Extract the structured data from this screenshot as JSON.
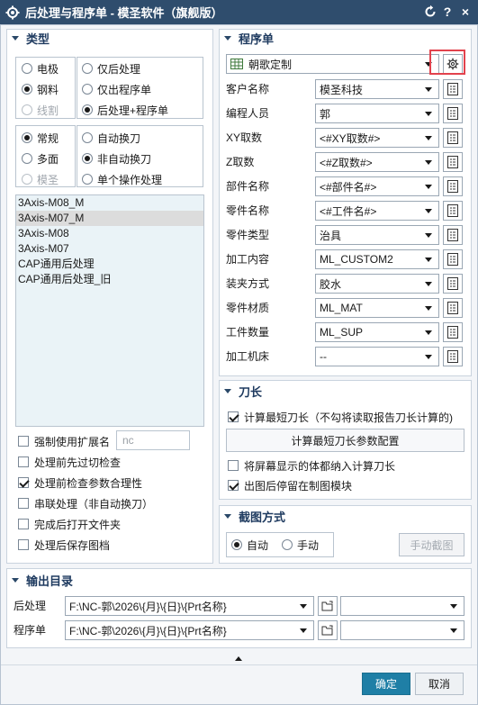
{
  "window": {
    "title": "后处理与程序单 - 模圣软件（旗舰版）",
    "refresh_icon": "refresh-icon",
    "help_label": "?",
    "close_label": "×"
  },
  "type_section": {
    "title": "类型",
    "group1": [
      {
        "label": "电极",
        "checked": false,
        "disabled": false
      },
      {
        "label": "钢料",
        "checked": true,
        "disabled": false
      },
      {
        "label": "线割",
        "checked": false,
        "disabled": true
      }
    ],
    "group2": [
      {
        "label": "仅后处理",
        "checked": false
      },
      {
        "label": "仅出程序单",
        "checked": false
      },
      {
        "label": "后处理+程序单",
        "checked": true
      }
    ],
    "group3": [
      {
        "label": "常规",
        "checked": true,
        "disabled": false
      },
      {
        "label": "多面",
        "checked": false,
        "disabled": false
      },
      {
        "label": "模圣",
        "checked": false,
        "disabled": true
      }
    ],
    "group4": [
      {
        "label": "自动换刀",
        "checked": false
      },
      {
        "label": "非自动换刀",
        "checked": true
      },
      {
        "label": "单个操作处理",
        "checked": false
      }
    ],
    "posts": [
      "3Axis-M08_M",
      "3Axis-M07_M",
      "3Axis-M08",
      "3Axis-M07",
      "CAP通用后处理",
      "CAP通用后处理_旧"
    ],
    "selected_post": "3Axis-M07_M",
    "options": {
      "force_ext": {
        "label": "强制使用扩展名",
        "checked": false,
        "value": "nc"
      },
      "precut": {
        "label": "处理前先过切检查",
        "checked": false
      },
      "check_params": {
        "label": "处理前检查参数合理性",
        "checked": true
      },
      "serial": {
        "label": "串联处理（非自动换刀）",
        "checked": false
      },
      "open_folder": {
        "label": "完成后打开文件夹",
        "checked": false
      },
      "save_drawing": {
        "label": "处理后保存图档",
        "checked": false
      }
    }
  },
  "program_section": {
    "title": "程序单",
    "template": "朝歌定制",
    "settings_icon": "gear-icon",
    "rows": [
      {
        "label": "客户名称",
        "value": "模圣科技"
      },
      {
        "label": "编程人员",
        "value": "郭"
      },
      {
        "label": "XY取数",
        "value": "<#XY取数#>"
      },
      {
        "label": "Z取数",
        "value": "<#Z取数#>"
      },
      {
        "label": "部件名称",
        "value": "<#部件名#>"
      },
      {
        "label": "零件名称",
        "value": "<#工件名#>"
      },
      {
        "label": "零件类型",
        "value": "治具"
      },
      {
        "label": "加工内容",
        "value": "ML_CUSTOM2"
      },
      {
        "label": "装夹方式",
        "value": "胶水"
      },
      {
        "label": "零件材质",
        "value": "ML_MAT"
      },
      {
        "label": "工件数量",
        "value": "ML_SUP"
      },
      {
        "label": "加工机床",
        "value": "--"
      }
    ]
  },
  "tool_section": {
    "title": "刀长",
    "calc_shortest": {
      "label": "计算最短刀长（不勾将读取报告刀长计算的)",
      "checked": true
    },
    "config_button": "计算最短刀长参数配置",
    "include_visible": {
      "label": "将屏幕显示的体都纳入计算刀长",
      "checked": false
    },
    "stay_drawing": {
      "label": "出图后停留在制图模块",
      "checked": true
    }
  },
  "capture_section": {
    "title": "截图方式",
    "auto": {
      "label": "自动",
      "checked": true
    },
    "manual": {
      "label": "手动",
      "checked": false
    },
    "manual_button": "手动截图"
  },
  "output_section": {
    "title": "输出目录",
    "post_label": "后处理",
    "post_path": "F:\\NC-郭\\2026\\{月}\\{日}\\{Prt名称}",
    "program_label": "程序单",
    "program_path": "F:\\NC-郭\\2026\\{月}\\{日}\\{Prt名称}"
  },
  "footer": {
    "ok": "确定",
    "cancel": "取消"
  },
  "colors": {
    "titlebar": "#2f4d6d",
    "primary_button": "#1f7fa6",
    "highlight": "#e2424d"
  }
}
